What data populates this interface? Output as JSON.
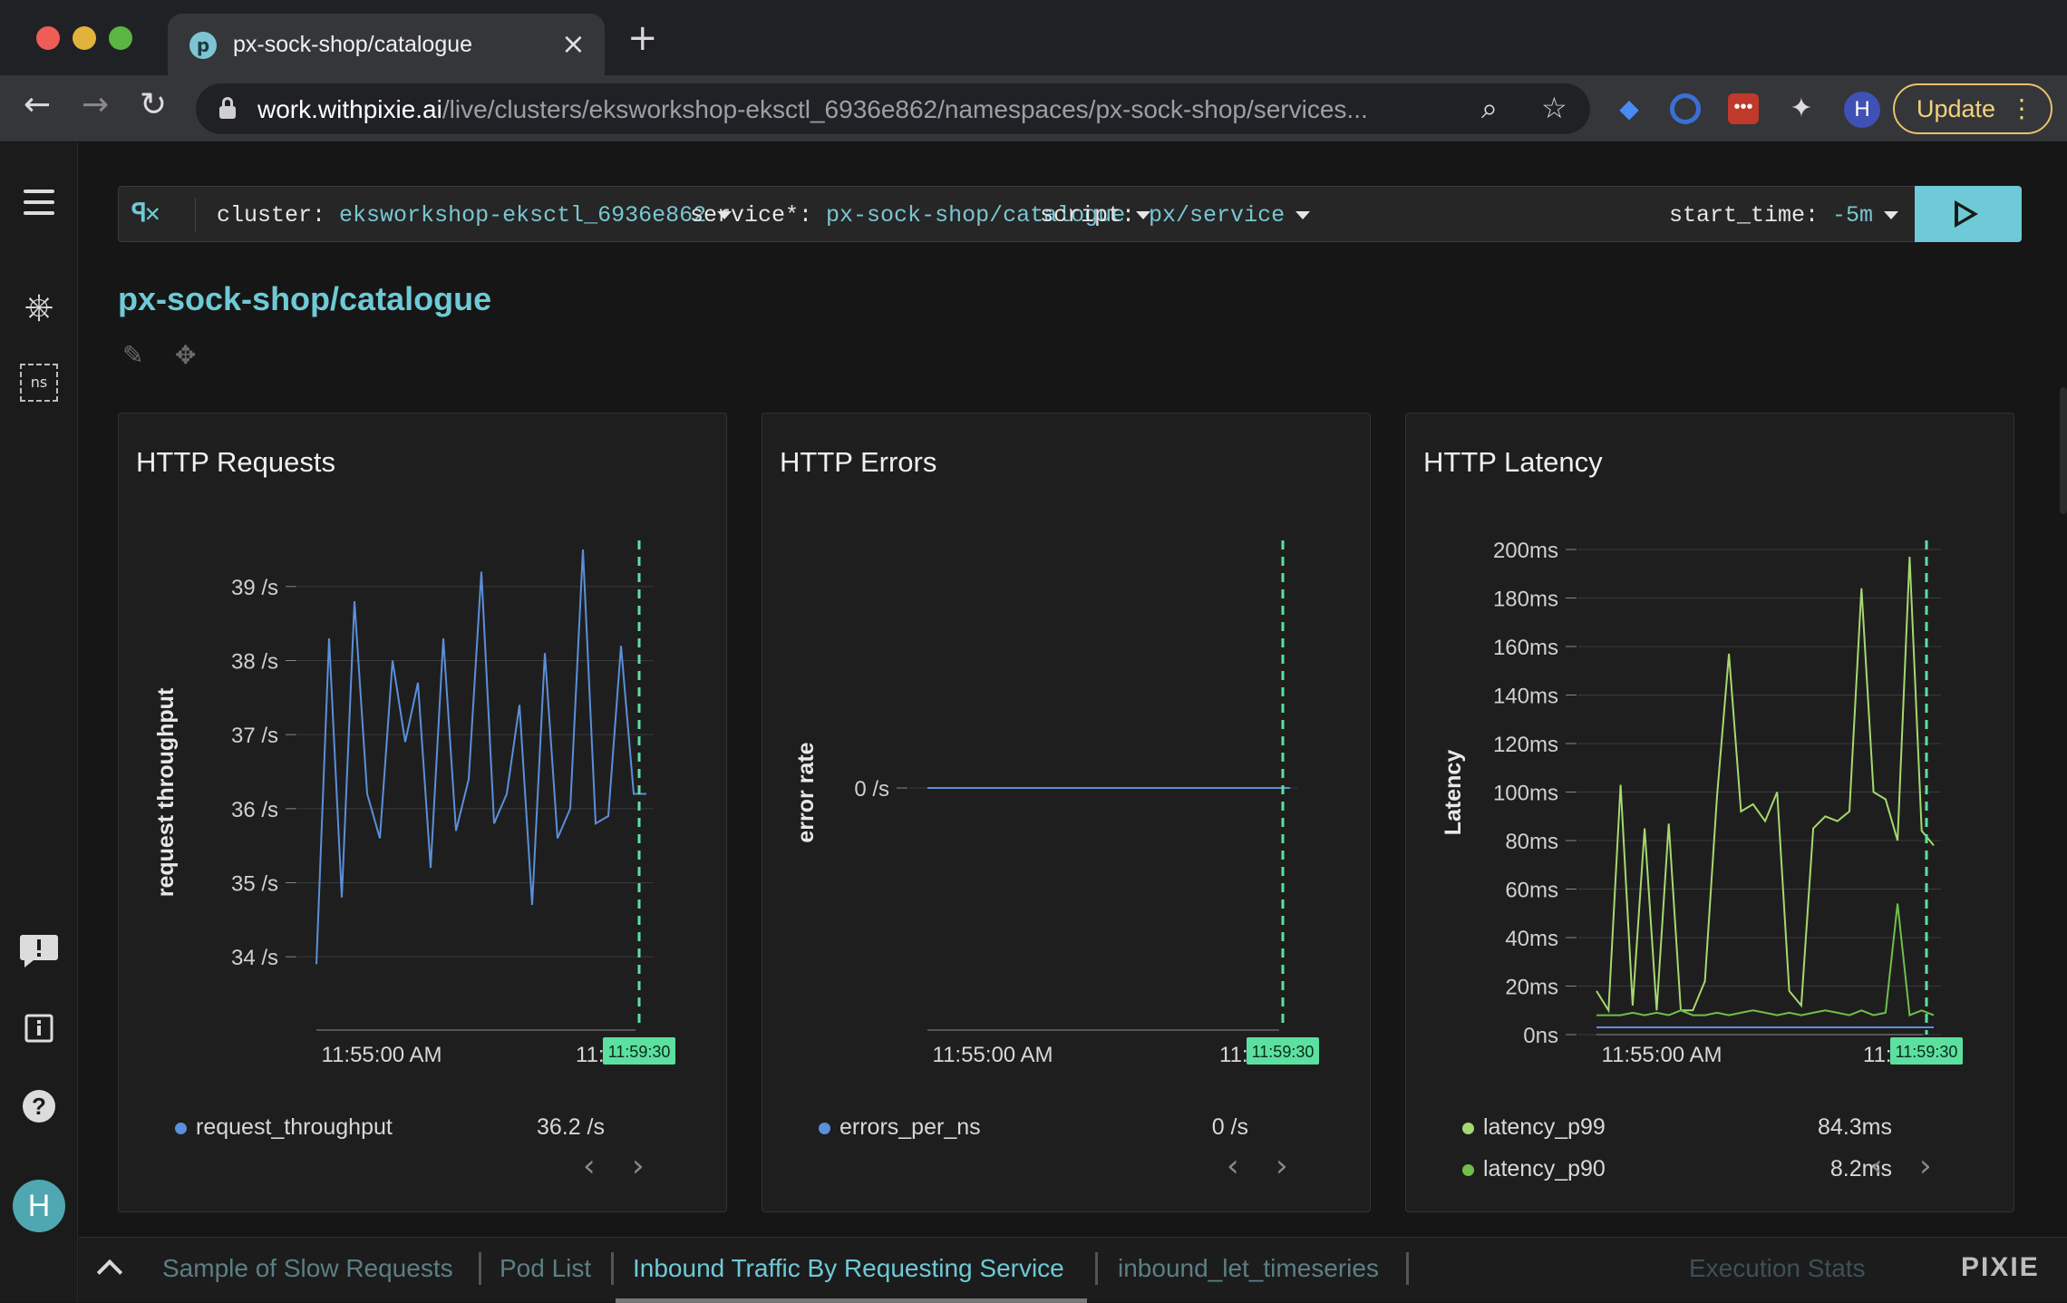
{
  "browser": {
    "tab_title": "px-sock-shop/catalogue",
    "tab_favicon": "pixie-favicon",
    "url_host": "work.withpixie.ai",
    "url_path": "/live/clusters/eksworkshop-eksctl_6936e862/namespaces/px-sock-shop/services...",
    "profile_initial": "H",
    "update_label": "Update"
  },
  "sidebar": {
    "ns_label": "ns",
    "avatar_initial": "H"
  },
  "querybar": {
    "cluster_key": "cluster:",
    "cluster_val": "eksworkshop-eksctl_6936e862",
    "service_key": "service*:",
    "service_val": "px-sock-shop/catalogue",
    "script_key": "script:",
    "script_val": "px/service",
    "start_key": "start_time:",
    "start_val": "-5m"
  },
  "page": {
    "title": "px-sock-shop/catalogue"
  },
  "colors": {
    "accent": "#6ecad6",
    "series_blue": "#5b8fd9",
    "series_green_light": "#a6d86f",
    "series_green": "#6fbf4a",
    "cursor_label_bg": "#5ce0a0"
  },
  "cards": [
    {
      "title": "HTTP Requests",
      "legend": [
        {
          "name": "request_throughput",
          "value": "36.2 /s"
        }
      ]
    },
    {
      "title": "HTTP Errors",
      "legend": [
        {
          "name": "errors_per_ns",
          "value": "0 /s"
        }
      ]
    },
    {
      "title": "HTTP Latency",
      "legend": [
        {
          "name": "latency_p99",
          "value": "84.3ms"
        },
        {
          "name": "latency_p90",
          "value": "8.2ms"
        }
      ]
    }
  ],
  "chart_data": [
    {
      "type": "line",
      "title": "HTTP Requests",
      "ylabel": "request throughput",
      "yticks": [
        "34 /s",
        "35 /s",
        "36 /s",
        "37 /s",
        "38 /s",
        "39 /s"
      ],
      "ylim": [
        33.5,
        39.5
      ],
      "xticks": [
        "11:55:00 AM",
        "11:59:"
      ],
      "cursor_label": "11:59:30",
      "series": [
        {
          "name": "request_throughput",
          "values": [
            33.9,
            38.3,
            34.8,
            38.8,
            36.2,
            35.6,
            38.0,
            36.9,
            37.7,
            35.2,
            38.3,
            35.7,
            36.4,
            39.2,
            35.8,
            36.2,
            37.4,
            34.7,
            38.1,
            35.6,
            36.0,
            39.5,
            35.8,
            35.9,
            38.2,
            36.2,
            36.2
          ]
        }
      ]
    },
    {
      "type": "line",
      "title": "HTTP Errors",
      "ylabel": "error rate",
      "yticks": [
        "0 /s"
      ],
      "xticks": [
        "11:55:00 AM",
        "11:59:"
      ],
      "cursor_label": "11:59:30",
      "series": [
        {
          "name": "errors_per_ns",
          "values": [
            0,
            0,
            0,
            0,
            0,
            0,
            0,
            0,
            0,
            0,
            0,
            0,
            0
          ]
        }
      ]
    },
    {
      "type": "line",
      "title": "HTTP Latency",
      "ylabel": "Latency",
      "yticks": [
        "0ns",
        "20ms",
        "40ms",
        "60ms",
        "80ms",
        "100ms",
        "120ms",
        "140ms",
        "160ms",
        "180ms",
        "200ms"
      ],
      "ylim": [
        0,
        200
      ],
      "xticks": [
        "11:55:00 AM",
        "11:59:"
      ],
      "cursor_label": "11:59:30",
      "series": [
        {
          "name": "latency_p99",
          "values": [
            18,
            10,
            103,
            12,
            85,
            10,
            87,
            10,
            10,
            22,
            98,
            157,
            92,
            95,
            88,
            100,
            18,
            12,
            85,
            90,
            88,
            92,
            184,
            100,
            97,
            80,
            197,
            84,
            78
          ]
        },
        {
          "name": "latency_p90",
          "values": [
            8,
            8,
            8,
            9,
            8,
            9,
            8,
            10,
            8,
            8,
            9,
            8,
            9,
            10,
            9,
            8,
            9,
            8,
            9,
            10,
            9,
            8,
            10,
            8,
            9,
            54,
            8,
            10,
            8
          ]
        },
        {
          "name": "",
          "values": [
            3,
            3,
            3,
            3,
            3,
            3,
            3,
            3,
            3,
            3,
            3,
            3,
            3,
            3,
            3,
            3,
            3,
            3,
            3,
            3,
            3,
            3,
            3,
            3,
            3,
            3,
            3,
            3,
            3
          ]
        }
      ]
    }
  ],
  "bottom_tabs": [
    {
      "label": "Sample of Slow Requests",
      "active": false
    },
    {
      "label": "Pod List",
      "active": false
    },
    {
      "label": "Inbound Traffic By Requesting Service",
      "active": true
    },
    {
      "label": "inbound_let_timeseries",
      "active": false
    }
  ],
  "bottom_right": {
    "exec_stats": "Execution Stats",
    "logo": "PIXIE"
  }
}
